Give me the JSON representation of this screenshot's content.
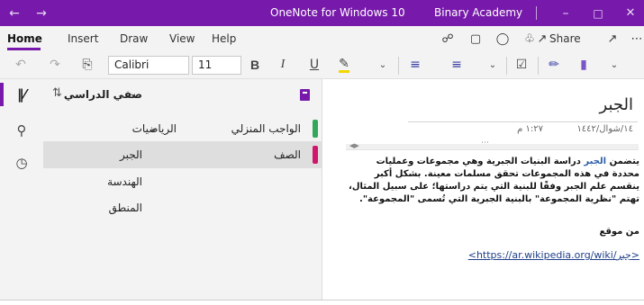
{
  "titlebar": {
    "title": "OneNote for Windows 10",
    "account": "Binary Academy",
    "back_icon": "back-arrow-icon",
    "forward_icon": "forward-arrow-icon",
    "minimize_icon": "minimize-icon",
    "maximize_icon": "maximize-icon",
    "close_icon": "close-icon",
    "accent_color": "#7719aa"
  },
  "ribbon": {
    "tabs": [
      "Home",
      "Insert",
      "Draw",
      "View",
      "Help"
    ],
    "active_tab": "Home",
    "share_label": "Share"
  },
  "toolbar": {
    "font_name": "Calibri",
    "font_size": "11"
  },
  "notebook": {
    "name": "صفي الدراسي"
  },
  "sections": [
    {
      "label": "الواجب المنزلي",
      "color": "#33a85b"
    },
    {
      "label": "الصف",
      "color": "#d1176c"
    }
  ],
  "section_group": {
    "label": "الرياضيات"
  },
  "pages": [
    {
      "label": "الجبر"
    },
    {
      "label": "الهندسة"
    },
    {
      "label": "المنطق"
    }
  ],
  "note": {
    "title": "الجبر",
    "date": "١٤/شوال/١٤٤٢",
    "time": "١:٢٧ م",
    "body_prefix": "يتضمن",
    "body_link_word": "الجبر",
    "body_rest": "دراسة البنيات الجبرية وهي مجموعات وعمليات محددة في هذه المجموعات تحقق مسلمات معينة. بشكل أكبر ينقسم علم الجبر وفقًا للبنية التي يتم دراستها؛ على سبيل المثال، تهتم \"نظرية المجموعة\" بالبنية الجبرية التي تُسمى \"المجموعة\".",
    "source_label": "من موقع",
    "source_url": "<https://ar.wikipedia.org/wiki/جبر>"
  }
}
